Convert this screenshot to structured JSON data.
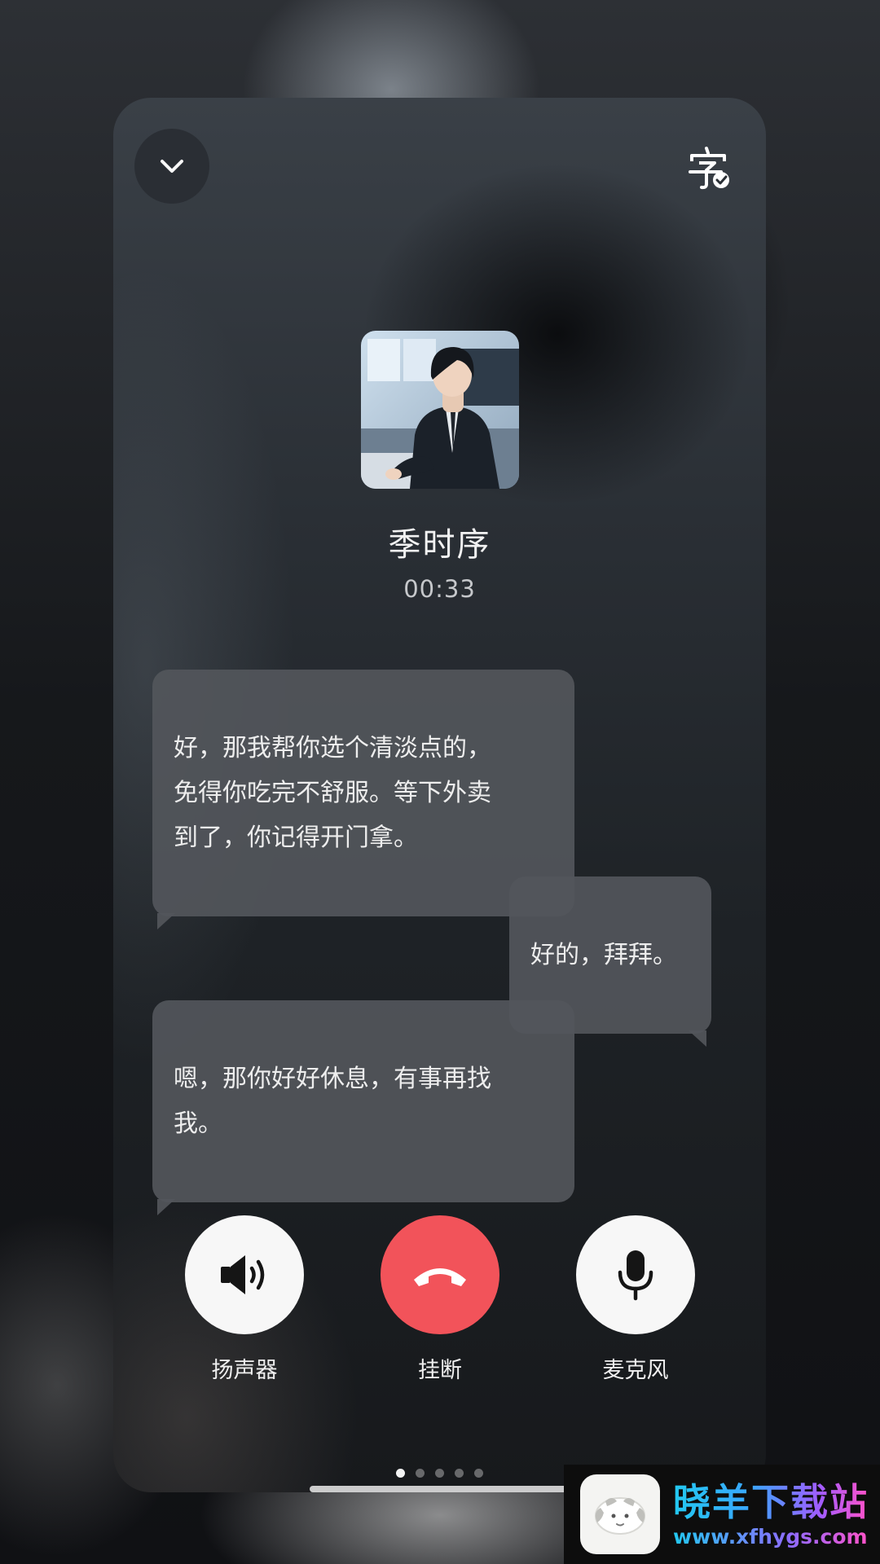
{
  "call": {
    "contact_name": "季时序",
    "duration": "00:33"
  },
  "header": {
    "collapse_icon": "chevron-down-icon",
    "subtitle_icon": "subtitles-check-icon"
  },
  "avatar": {
    "description_icon": "avatar-image"
  },
  "messages": [
    {
      "side": "left",
      "text": "好，那我帮你选个清淡点的，\n免得你吃完不舒服。等下外卖\n到了，你记得开门拿。"
    },
    {
      "side": "right",
      "text": "好的，拜拜。"
    },
    {
      "side": "left",
      "text": "嗯，那你好好休息，有事再找\n我。"
    }
  ],
  "controls": {
    "speaker": {
      "label": "扬声器",
      "icon": "speaker-icon"
    },
    "hangup": {
      "label": "挂断",
      "icon": "hangup-phone-icon",
      "color": "#f2535a"
    },
    "microphone": {
      "label": "麦克风",
      "icon": "microphone-icon"
    }
  },
  "pager": {
    "total": 5,
    "active": 1
  },
  "watermark": {
    "name": "晓羊下载站",
    "url": "www.xfhygs.com"
  }
}
